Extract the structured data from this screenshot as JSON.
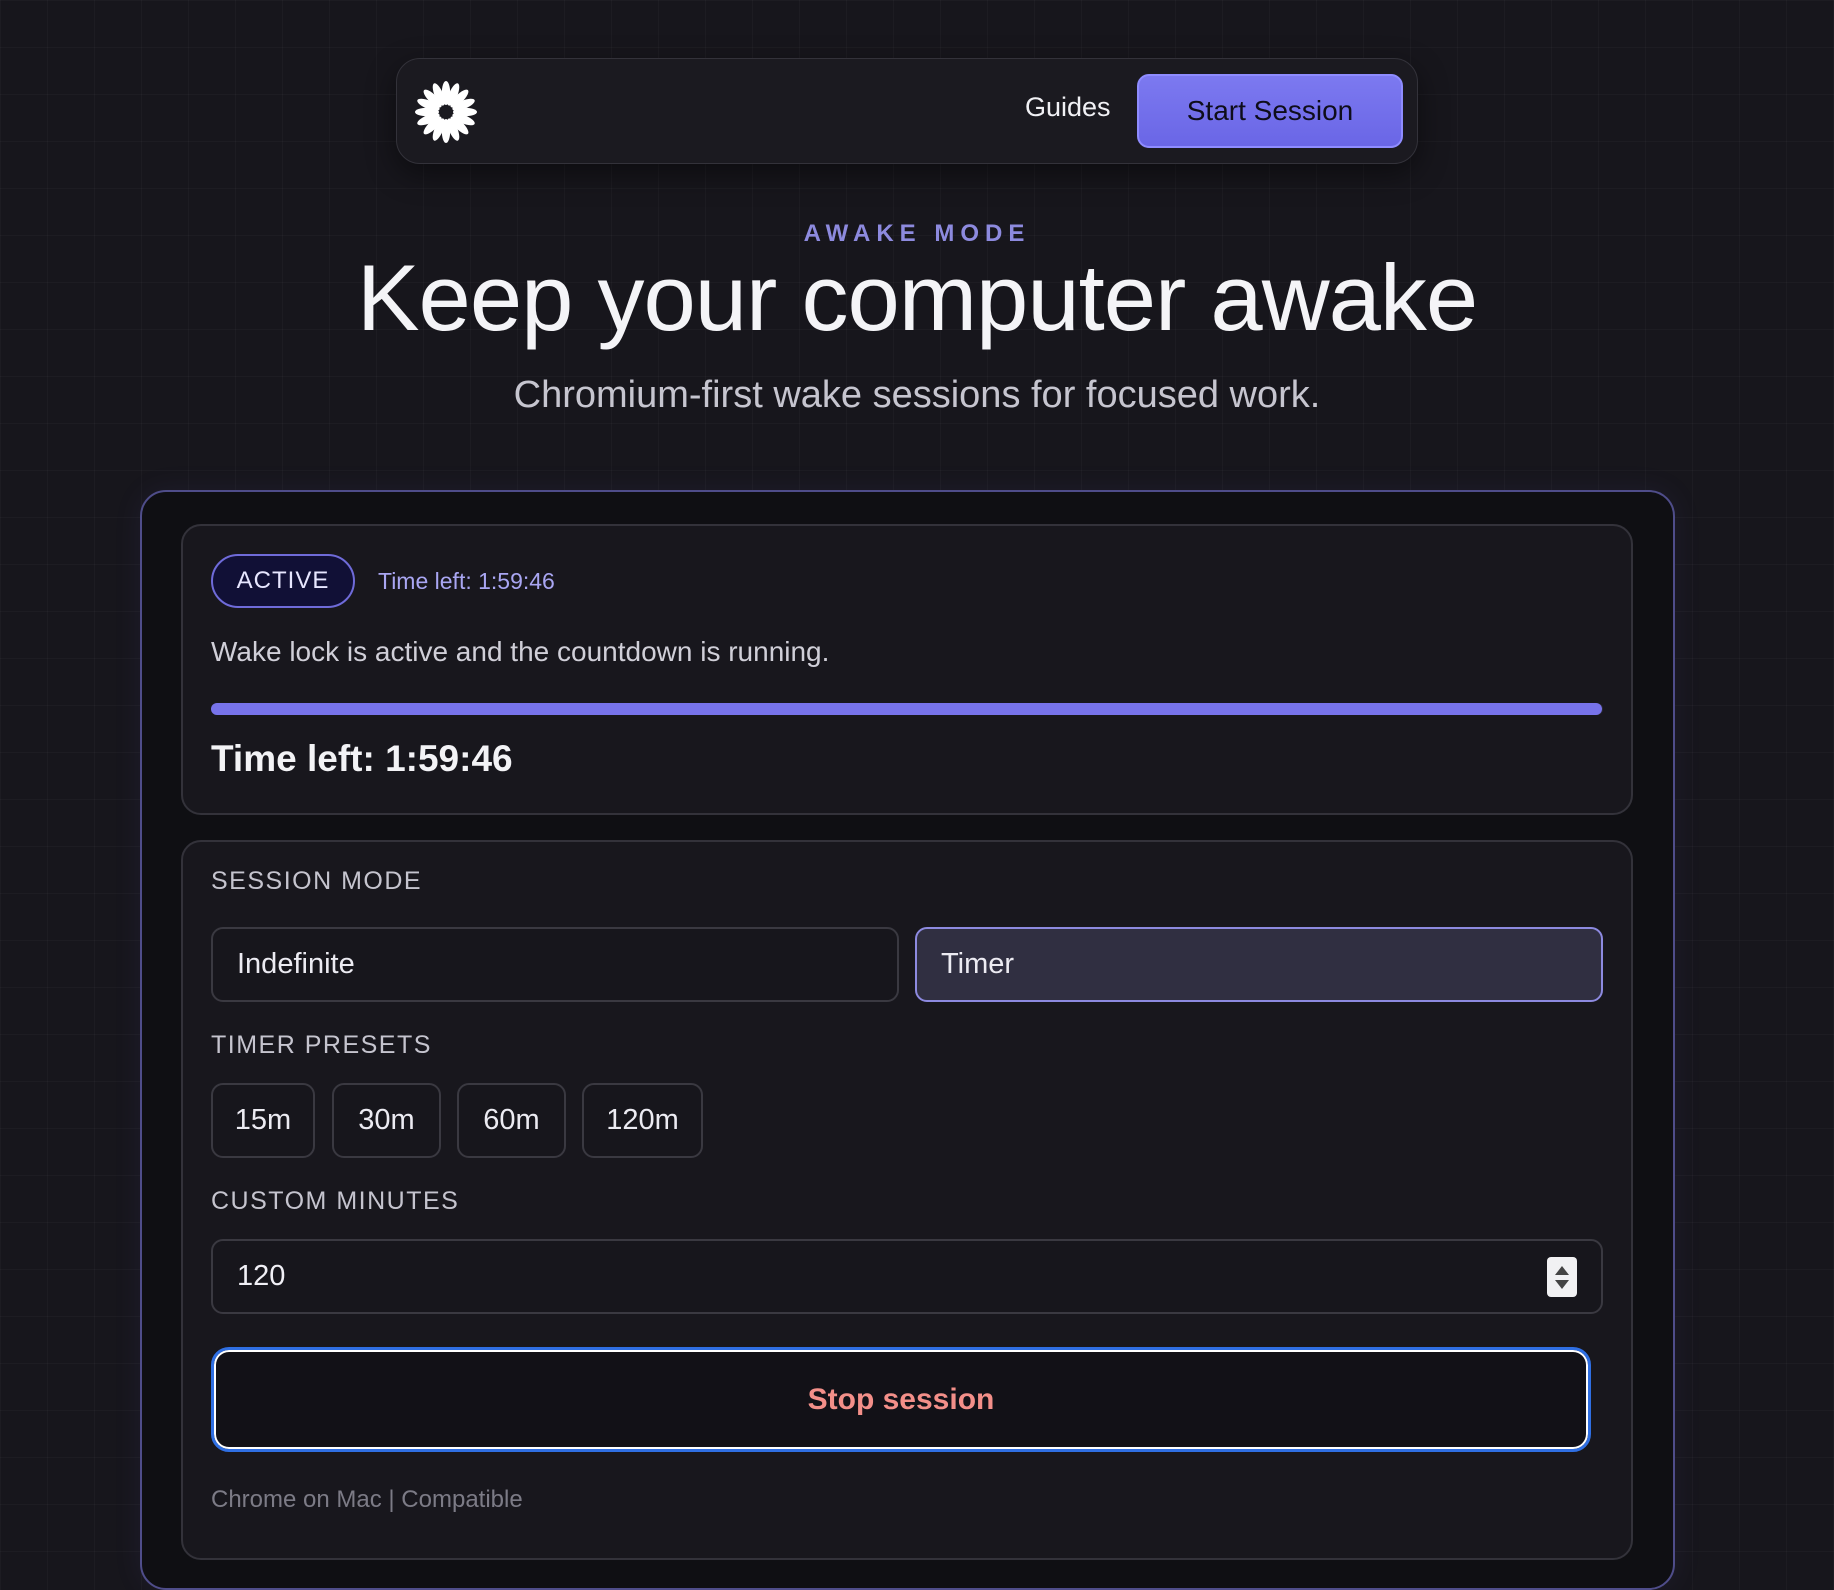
{
  "nav": {
    "logo_icon": "asterisk-flower-logo-icon",
    "guides_label": "Guides",
    "start_label": "Start Session"
  },
  "hero": {
    "eyebrow": "AWAKE MODE",
    "title": "Keep your computer awake",
    "subtitle": "Chromium-first wake sessions for focused work."
  },
  "status": {
    "badge": "ACTIVE",
    "time_left_small": "Time left: 1:59:46",
    "message": "Wake lock is active and the countdown is running.",
    "progress_fraction": 0.999,
    "time_left_large": "Time left: 1:59:46"
  },
  "controls": {
    "session_mode_label": "SESSION MODE",
    "modes": [
      {
        "label": "Indefinite",
        "selected": false
      },
      {
        "label": "Timer",
        "selected": true
      }
    ],
    "presets_label": "TIMER PRESETS",
    "presets": [
      "15m",
      "30m",
      "60m",
      "120m"
    ],
    "custom_label": "CUSTOM MINUTES",
    "custom_value": "120",
    "stop_label": "Stop session",
    "compat_text": "Chrome on Mac | Compatible"
  },
  "colors": {
    "accent": "#7773ea",
    "stop_text": "#f38f89",
    "focus_ring": "#2f6fe3"
  }
}
